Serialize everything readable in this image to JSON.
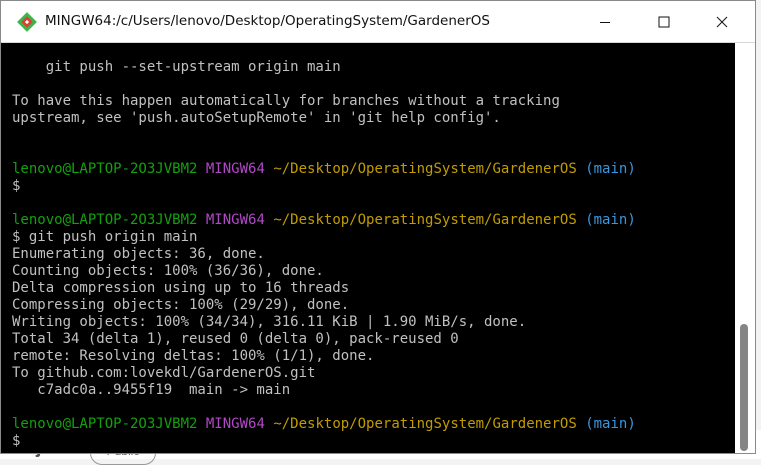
{
  "background": {
    "project_label": "Project",
    "badge_label": "Public"
  },
  "window": {
    "title": "MINGW64:/c/Users/lenovo/Desktop/OperatingSystem/GardenerOS",
    "app_icon": "git-bash-icon",
    "controls": {
      "minimize": "minimize-icon",
      "maximize": "maximize-icon",
      "close": "close-icon"
    }
  },
  "terminal": {
    "prompt": {
      "user_host": "lenovo@LAPTOP-2O3JVBM2",
      "env": "MINGW64",
      "path": "~/Desktop/OperatingSystem/GardenerOS",
      "branch": "(main)",
      "symbol": "$"
    },
    "line_push_upstream": "    git push --set-upstream origin main",
    "line_auto_1": "To have this happen automatically for branches without a tracking",
    "line_auto_2": "upstream, see 'push.autoSetupRemote' in 'git help config'.",
    "cmd_blank": "$",
    "cmd_push": "$ git push origin main",
    "output": [
      "Enumerating objects: 36, done.",
      "Counting objects: 100% (36/36), done.",
      "Delta compression using up to 16 threads",
      "Compressing objects: 100% (29/29), done.",
      "Writing objects: 100% (34/34), 316.11 KiB | 1.90 MiB/s, done.",
      "Total 34 (delta 1), reused 0 (delta 0), pack-reused 0",
      "remote: Resolving deltas: 100% (1/1), done.",
      "To github.com:lovekdl/GardenerOS.git",
      "   c7adc0a..9455f19  main -> main"
    ],
    "cmd_final": "$"
  },
  "colors": {
    "prompt_user": "#13a10e",
    "prompt_env": "#b148c6",
    "prompt_path": "#c19c00",
    "prompt_branch": "#3a96dd",
    "text": "#c0c0c0",
    "background": "#000000"
  }
}
